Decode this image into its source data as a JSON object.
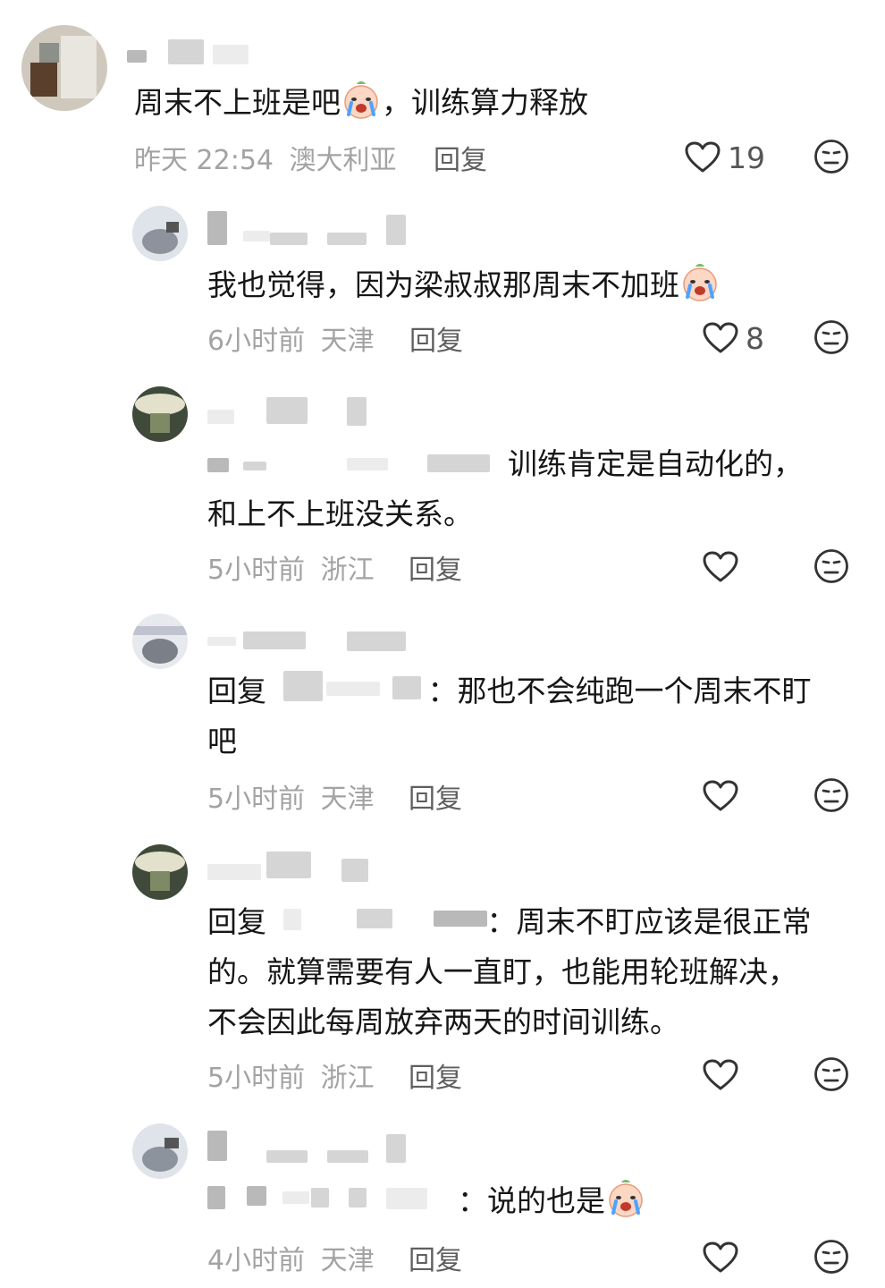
{
  "comments": [
    {
      "text_before_emoji": "周末不上班是吧",
      "text_after_emoji": "，训练算力释放",
      "time": "昨天 22:54",
      "location": "澳大利亚",
      "reply_label": "回复",
      "likes": "19"
    },
    {
      "text_before_emoji": "我也觉得，因为梁叔叔那周末不加班",
      "time": "6小时前",
      "location": "天津",
      "reply_label": "回复",
      "likes": "8"
    },
    {
      "line1_after_mention": "训练肯定是自动化的，",
      "line2": "和上不上班没关系。",
      "time": "5小时前",
      "location": "浙江",
      "reply_label": "回复"
    },
    {
      "prefix": "回复",
      "line1_after_mention": "：那也不会纯跑一个周末不盯",
      "line2": "吧",
      "time": "5小时前",
      "location": "天津",
      "reply_label": "回复"
    },
    {
      "prefix": "回复",
      "line1_after_mention": "：周末不盯应该是很正常",
      "line2": "的。就算需要有人一直盯，也能用轮班解决，",
      "line3": "不会因此每周放弃两天的时间训练。",
      "time": "5小时前",
      "location": "浙江",
      "reply_label": "回复"
    },
    {
      "line1_after_mention": "：说的也是",
      "time": "4小时前",
      "location": "天津",
      "reply_label": "回复"
    }
  ],
  "icons": {
    "like": "heart-outline-icon",
    "dislike": "neutral-face-icon",
    "emoji": "crying-face-emoji"
  },
  "colors": {
    "text": "#161616",
    "meta": "#a3a3a3",
    "icon": "#333333"
  }
}
